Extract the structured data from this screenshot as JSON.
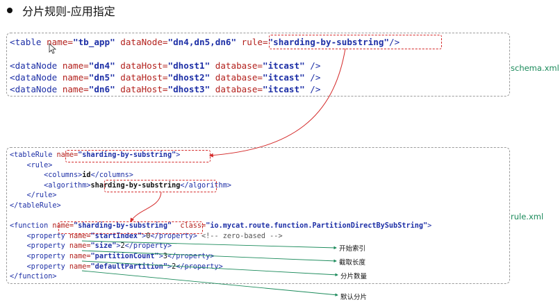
{
  "heading": "分片规则-应用指定",
  "schema": {
    "label": "schema.xml",
    "table_line": [
      {
        "text": "<table ",
        "c": "t"
      },
      {
        "text": "name=",
        "c": "a"
      },
      {
        "text": "\"tb_app\"",
        "c": "v"
      },
      {
        "text": " dataNode=",
        "c": "a"
      },
      {
        "text": "\"dn4,dn5,dn6\"",
        "c": "v"
      },
      {
        "text": " ",
        "c": "t"
      },
      {
        "text": "rule=",
        "c": "a"
      },
      {
        "text": "\"sharding-by-substring\"",
        "c": "v"
      },
      {
        "text": "/>",
        "c": "t"
      }
    ],
    "datanodes": [
      {
        "name": "\"dn4\"",
        "host": "\"dhost1\"",
        "db": "\"itcast\""
      },
      {
        "name": "\"dn5\"",
        "host": "\"dhost2\"",
        "db": "\"itcast\""
      },
      {
        "name": "\"dn6\"",
        "host": "\"dhost3\"",
        "db": "\"itcast\""
      }
    ]
  },
  "rule": {
    "label": "rule.xml",
    "lines": [
      [
        {
          "text": "<tableRule ",
          "c": "t"
        },
        {
          "text": "name=",
          "c": "a"
        },
        {
          "text": "\"sharding-by-substring\"",
          "c": "v"
        },
        {
          "text": ">",
          "c": "t"
        }
      ],
      [
        {
          "text": "    <rule>",
          "c": "t"
        }
      ],
      [
        {
          "text": "        <columns>",
          "c": "t"
        },
        {
          "text": "id",
          "c": "tx b"
        },
        {
          "text": "</columns>",
          "c": "t"
        }
      ],
      [
        {
          "text": "        <algorithm>",
          "c": "t"
        },
        {
          "text": "sharding-by-substring",
          "c": "tx b"
        },
        {
          "text": "</algorithm>",
          "c": "t"
        }
      ],
      [
        {
          "text": "    </rule>",
          "c": "t"
        }
      ],
      [
        {
          "text": "</tableRule>",
          "c": "t"
        }
      ],
      [
        {
          "text": "",
          "c": "t"
        }
      ],
      [
        {
          "text": "<function ",
          "c": "t"
        },
        {
          "text": "name=",
          "c": "a"
        },
        {
          "text": "\"sharding-by-substring\"",
          "c": "v"
        },
        {
          "text": "  ",
          "c": "t"
        },
        {
          "text": "class=",
          "c": "a"
        },
        {
          "text": "\"io.mycat.route.function.PartitionDirectBySubString\"",
          "c": "v"
        },
        {
          "text": ">",
          "c": "t"
        }
      ],
      [
        {
          "text": "    <property ",
          "c": "t"
        },
        {
          "text": "name=",
          "c": "a"
        },
        {
          "text": "\"startIndex\"",
          "c": "v"
        },
        {
          "text": ">",
          "c": "t"
        },
        {
          "text": "0",
          "c": "tx"
        },
        {
          "text": "</property>",
          "c": "t"
        },
        {
          "text": " <!-- zero-based -->",
          "c": "cm"
        }
      ],
      [
        {
          "text": "    <property ",
          "c": "t"
        },
        {
          "text": "name=",
          "c": "a"
        },
        {
          "text": "\"size\"",
          "c": "v"
        },
        {
          "text": ">",
          "c": "t"
        },
        {
          "text": "2",
          "c": "tx"
        },
        {
          "text": "</property>",
          "c": "t"
        }
      ],
      [
        {
          "text": "    <property ",
          "c": "t"
        },
        {
          "text": "name=",
          "c": "a"
        },
        {
          "text": "\"partitionCount\"",
          "c": "v"
        },
        {
          "text": ">",
          "c": "t"
        },
        {
          "text": "3",
          "c": "tx"
        },
        {
          "text": "</property>",
          "c": "t"
        }
      ],
      [
        {
          "text": "    <property ",
          "c": "t"
        },
        {
          "text": "name=",
          "c": "a"
        },
        {
          "text": "\"defaultPartition\"",
          "c": "v"
        },
        {
          "text": ">",
          "c": "t"
        },
        {
          "text": "2",
          "c": "tx"
        },
        {
          "text": "</property>",
          "c": "t"
        }
      ],
      [
        {
          "text": "</function>",
          "c": "t"
        }
      ]
    ]
  },
  "annotations": [
    "开始索引",
    "截取长度",
    "分片数量",
    "默认分片"
  ],
  "colors": {
    "tag": "#1d2fa6",
    "attr": "#b3211d",
    "highlight": "#d42a2a",
    "annotation_arrow": "#1a8a5a"
  }
}
